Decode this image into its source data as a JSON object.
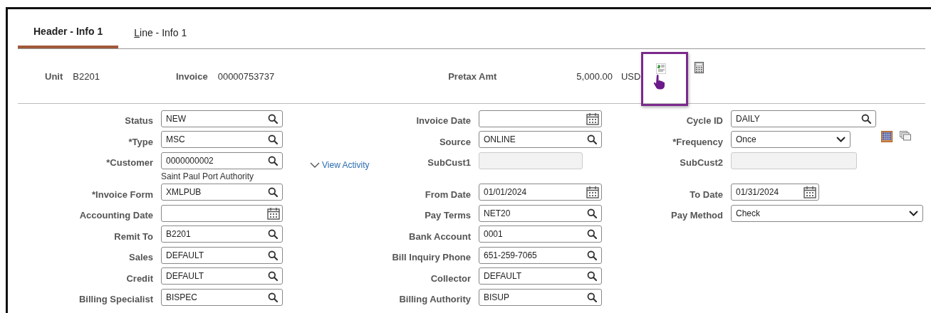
{
  "tabs": [
    {
      "label": "Header - Info 1",
      "selected": true,
      "underline_first": false
    },
    {
      "label": "Line - Info 1",
      "selected": false,
      "underline_first": true
    }
  ],
  "summary": [
    {
      "label": "Unit",
      "value": "B2201"
    },
    {
      "label": "Invoice",
      "value": "00000753737"
    },
    {
      "label": "Pretax Amt",
      "value": "5,000.00",
      "currency": "USD"
    }
  ],
  "summary_icons": [
    {
      "kind": "invoice",
      "highlighted": true
    },
    {
      "kind": "calculator",
      "highlighted": false
    }
  ],
  "rows": [
    {
      "left": {
        "label": "Status",
        "value": "NEW",
        "kind": "lookup"
      },
      "middle": {
        "label": "Invoice Date",
        "kind": "date"
      },
      "right": {
        "label": "Cycle ID",
        "value": "DAILY",
        "kind": "lookup"
      }
    },
    {
      "left": {
        "label": "*Type",
        "value": "MSC",
        "kind": "lookup"
      },
      "middle": {
        "label": "Source",
        "value": "ONLINE",
        "kind": "lookup"
      },
      "right": {
        "label": "*Frequency",
        "value": "Once",
        "kind": "select"
      },
      "side_icons": [
        {
          "kind": "grid"
        },
        {
          "kind": "copy"
        }
      ]
    },
    {
      "left": {
        "label": "*Customer",
        "value": "0000000002",
        "kind": "lookup",
        "link": "View Activity"
      },
      "middle": {
        "label": "SubCust1",
        "kind": "display"
      },
      "right": {
        "label": "SubCust2",
        "kind": "display"
      }
    },
    {
      "note": "Saint Paul Port Authority"
    },
    {
      "left": {
        "label": "*Invoice Form",
        "value": "XMLPUB",
        "kind": "lookup"
      },
      "middle": {
        "label": "From Date",
        "value": "01/01/2024",
        "kind": "date"
      },
      "right": {
        "label": "To Date",
        "value": "01/31/2024",
        "kind": "date"
      }
    },
    {
      "left": {
        "label": "Accounting Date",
        "kind": "date"
      },
      "middle": {
        "label": "Pay Terms",
        "value": "NET20",
        "kind": "lookup"
      },
      "right": {
        "label": "Pay Method",
        "value": "Check",
        "kind": "select"
      }
    },
    {
      "left": {
        "label": "Remit To",
        "value": "B2201",
        "kind": "lookup"
      },
      "middle": {
        "label": "Bank Account",
        "value": "0001",
        "kind": "lookup"
      }
    },
    {
      "left": {
        "label": "Sales",
        "value": "DEFAULT",
        "kind": "lookup"
      },
      "middle": {
        "label": "Bill Inquiry Phone",
        "value": "651-259-7065",
        "kind": "lookup"
      }
    },
    {
      "left": {
        "label": "Credit",
        "value": "DEFAULT",
        "kind": "lookup"
      },
      "middle": {
        "label": "Collector",
        "value": "DEFAULT",
        "kind": "lookup"
      }
    },
    {
      "left": {
        "label": "Billing Specialist",
        "value": "BISPEC",
        "kind": "lookup"
      },
      "middle": {
        "label": "Billing Authority",
        "value": "BISUP",
        "kind": "lookup"
      }
    }
  ]
}
